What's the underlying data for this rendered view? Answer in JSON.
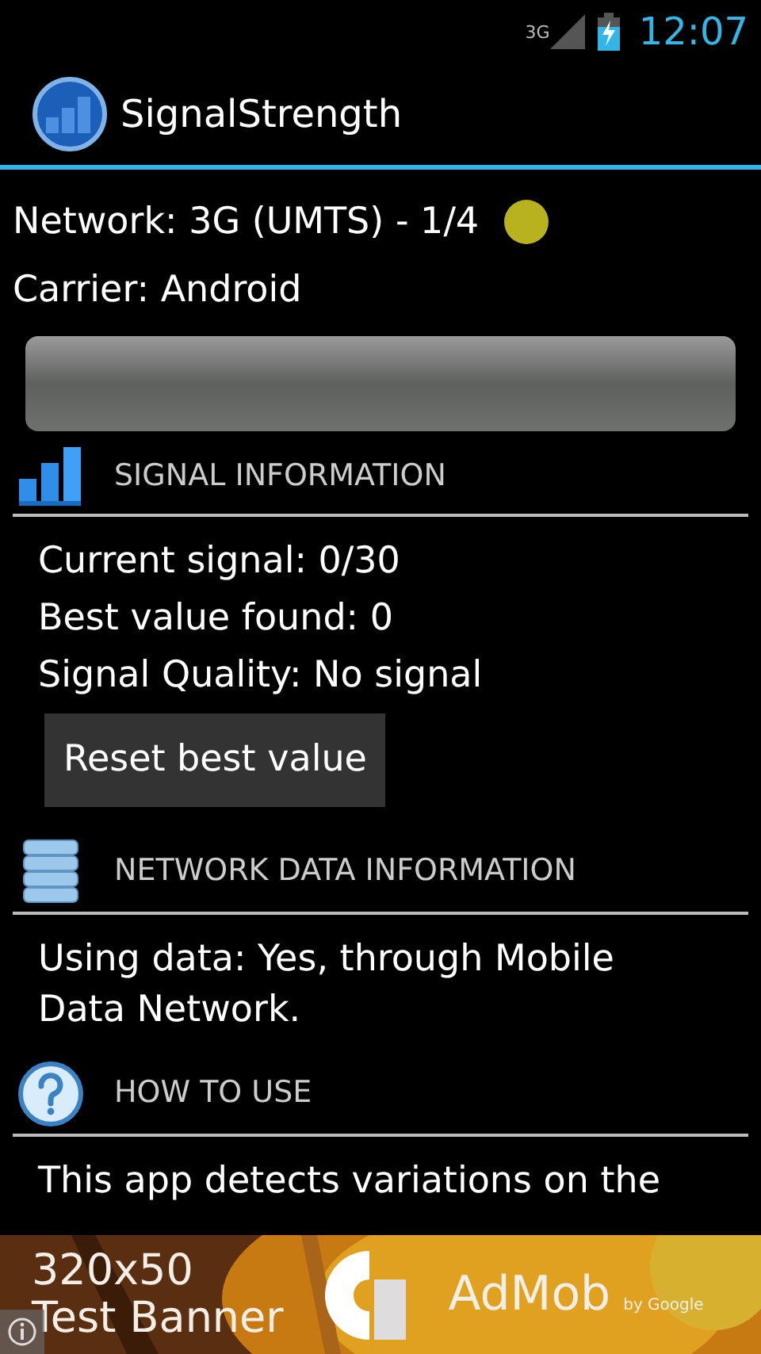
{
  "status_bar": {
    "network": "3G",
    "time": "12:07"
  },
  "app_bar": {
    "title": "SignalStrength"
  },
  "network": "Network: 3G (UMTS) - 1/4",
  "carrier": "Carrier: Android",
  "signal_meter": {
    "level": 0
  },
  "sections": [
    {
      "kind": "signal",
      "title": "SIGNAL INFORMATION",
      "lines": [
        "Current signal: 0/30",
        "Best value found: 0",
        "Signal Quality: No signal"
      ],
      "button": "Reset best value"
    },
    {
      "kind": "data",
      "title": "NETWORK DATA INFORMATION",
      "lines": [
        "Using data: Yes, through Mobile Data Network."
      ]
    },
    {
      "kind": "help",
      "title": "HOW TO USE",
      "lines": [
        "This app detects variations on the"
      ]
    }
  ],
  "ad": {
    "size": "320x50",
    "label": "Test Banner",
    "brand": "AdMob",
    "byline": "by Google"
  }
}
